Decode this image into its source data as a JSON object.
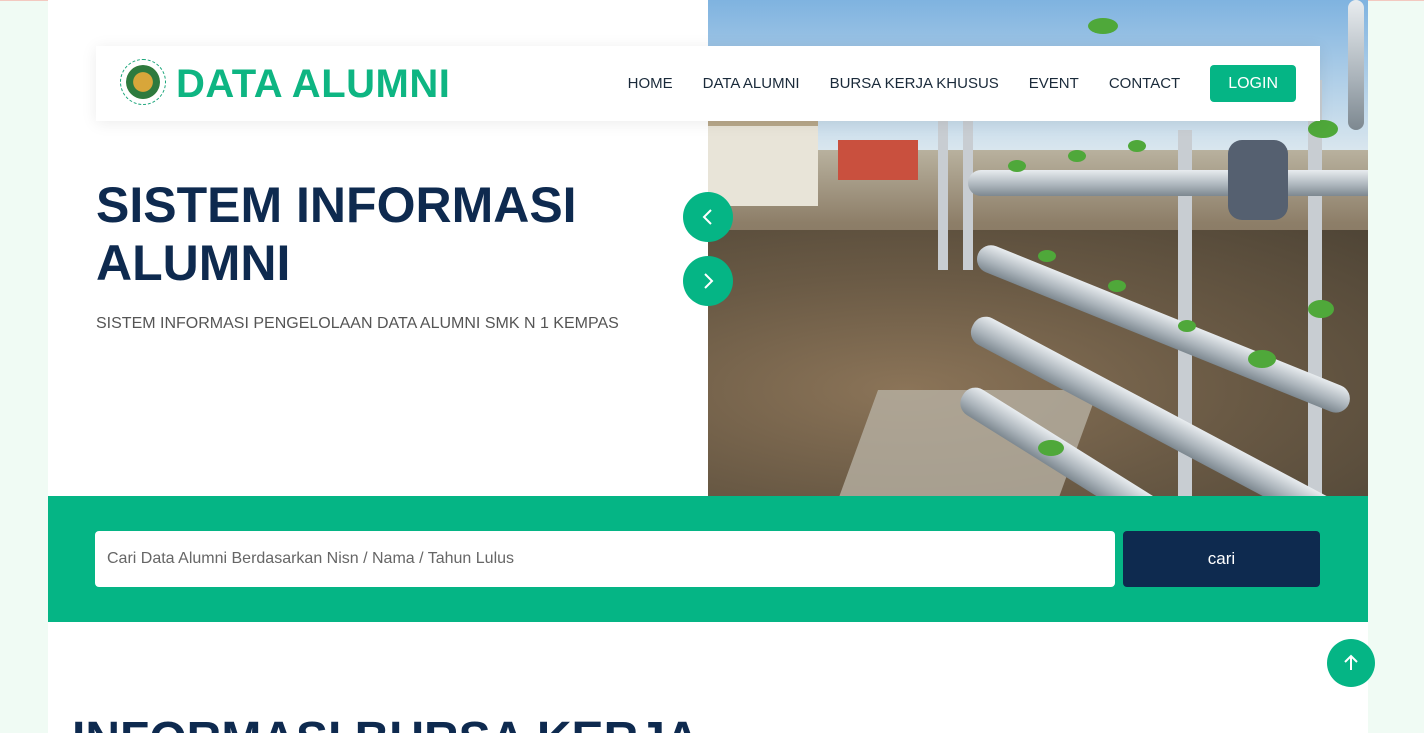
{
  "brand": {
    "title": "DATA ALUMNI",
    "logo_icon": "school-emblem-icon"
  },
  "nav": {
    "items": [
      "HOME",
      "DATA ALUMNI",
      "BURSA KERJA KHUSUS",
      "EVENT",
      "CONTACT"
    ],
    "login_label": "LOGIN"
  },
  "hero": {
    "title_line1": "SISTEM INFORMASI",
    "title_line2": "ALUMNI",
    "subtitle": "SISTEM INFORMASI PENGELOLAAN DATA ALUMNI SMK N 1 KEMPAS",
    "prev_icon": "chevron-left-icon",
    "next_icon": "chevron-right-icon"
  },
  "search": {
    "placeholder": "Cari Data Alumni Berdasarkan Nisn / Nama / Tahun Lulus",
    "value": "",
    "button_label": "cari"
  },
  "section": {
    "title": "INFORMASI BURSA KERJA"
  },
  "colors": {
    "accent": "#05b585",
    "navy": "#0e2a4f"
  }
}
